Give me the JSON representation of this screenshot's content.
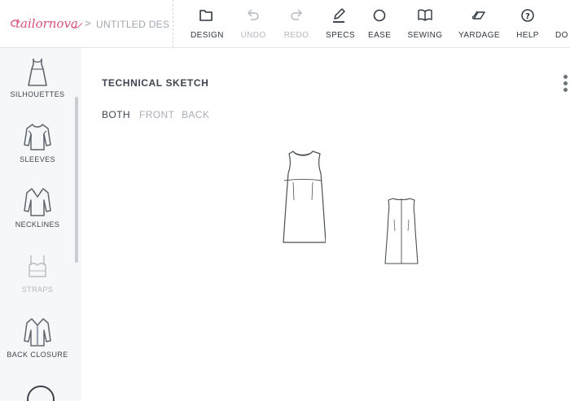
{
  "brand": {
    "logo_text": "tailornova"
  },
  "breadcrumb": {
    "separator": ">",
    "document_title": "UNTITLED DES"
  },
  "toolbar": {
    "items": [
      {
        "label": "DESIGN",
        "icon": "folder-icon",
        "enabled": true
      },
      {
        "label": "UNDO",
        "icon": "undo-icon",
        "enabled": false
      },
      {
        "label": "REDO",
        "icon": "redo-icon",
        "enabled": false
      },
      {
        "label": "SPECS",
        "icon": "pencil-icon",
        "enabled": true
      },
      {
        "label": "EASE",
        "icon": "circle-icon",
        "enabled": true
      },
      {
        "label": "SEWING",
        "icon": "book-icon",
        "enabled": true
      },
      {
        "label": "YARDAGE",
        "icon": "fabric-icon",
        "enabled": true
      },
      {
        "label": "HELP",
        "icon": "help-icon",
        "enabled": true
      },
      {
        "label": "DO",
        "icon": "",
        "enabled": true
      }
    ]
  },
  "sidebar": {
    "items": [
      {
        "label": "SILHOUETTES",
        "icon": "dress-silhouette-icon",
        "enabled": true
      },
      {
        "label": "SLEEVES",
        "icon": "sleeves-icon",
        "enabled": true
      },
      {
        "label": "NECKLINES",
        "icon": "neckline-icon",
        "enabled": true
      },
      {
        "label": "STRAPS",
        "icon": "straps-icon",
        "enabled": false
      },
      {
        "label": "BACK CLOSURE",
        "icon": "back-closure-icon",
        "enabled": true
      }
    ]
  },
  "main": {
    "title": "TECHNICAL SKETCH",
    "view_tabs": [
      {
        "label": "BOTH",
        "active": true
      },
      {
        "label": "FRONT",
        "active": false
      },
      {
        "label": "BACK",
        "active": false
      }
    ]
  },
  "colors": {
    "brand_pink": "#d9537a",
    "text_dark": "#2e363e",
    "text_disabled": "#b4bac0",
    "sidebar_bg": "#f6f7f8",
    "sketch_line": "#4a4f55"
  }
}
